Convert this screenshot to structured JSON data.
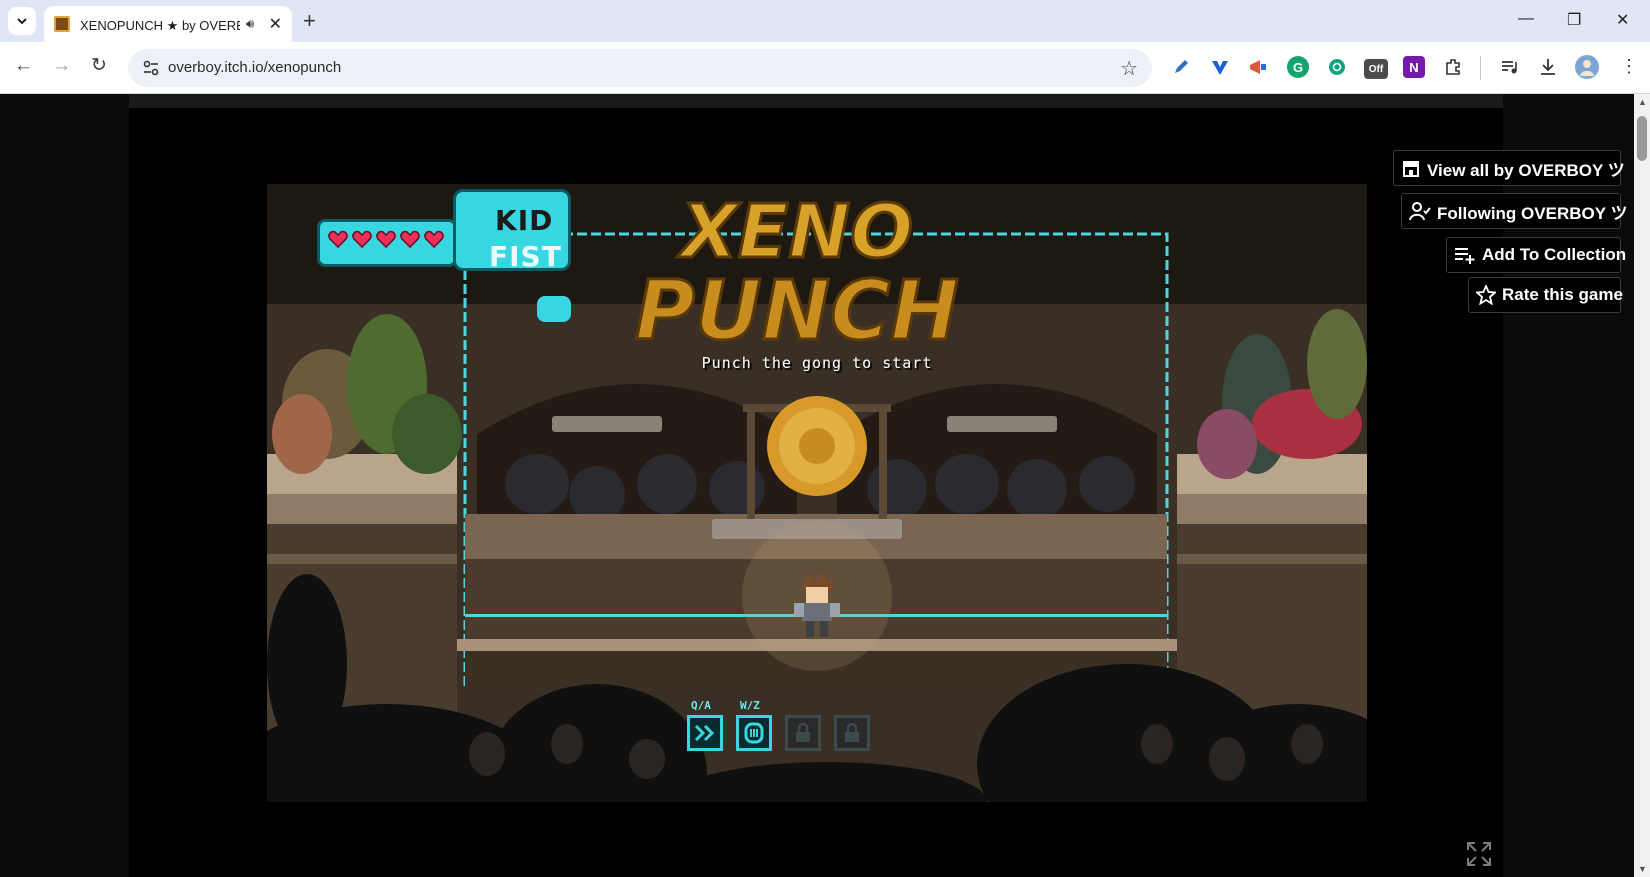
{
  "browser": {
    "tab": {
      "title": "XENOPUNCH ★ by OVERBOY ツ",
      "audio_icon": "speaker-icon",
      "close_glyph": "✕"
    },
    "new_tab_glyph": "+",
    "window_controls": {
      "minimize": "—",
      "restore": "❐",
      "close": "✕"
    },
    "nav": {
      "back": "←",
      "forward": "→",
      "reload": "↻"
    },
    "url": "overboy.itch.io/xenopunch",
    "bookmark_glyph": "☆",
    "extension_badge": "Off"
  },
  "page": {
    "actions": {
      "view_all": "View all by OVERBOY ツ",
      "following": "Following OVERBOY ツ",
      "add_to_collection": "Add To Collection",
      "rate": "Rate this game"
    }
  },
  "game": {
    "title_line1": "XENO",
    "title_line2": "PUNCH",
    "character_name_top": "KID",
    "character_name_bottom": "FIST",
    "hearts": 5,
    "subtitle": "Punch the gong to start",
    "controls": [
      {
        "key": "Q/A",
        "icon": "dash-icon",
        "locked": false
      },
      {
        "key": "W/Z",
        "icon": "shield-icon",
        "locked": false
      },
      {
        "key": "",
        "icon": "lock-icon",
        "locked": true
      },
      {
        "key": "",
        "icon": "lock-icon",
        "locked": true
      }
    ]
  },
  "colors": {
    "tab_strip": "#dfe6f4",
    "omnibox": "#eef1f7",
    "game_accent": "#38d6e0",
    "heart": "#e8305a",
    "gong": "#d79a2a"
  }
}
